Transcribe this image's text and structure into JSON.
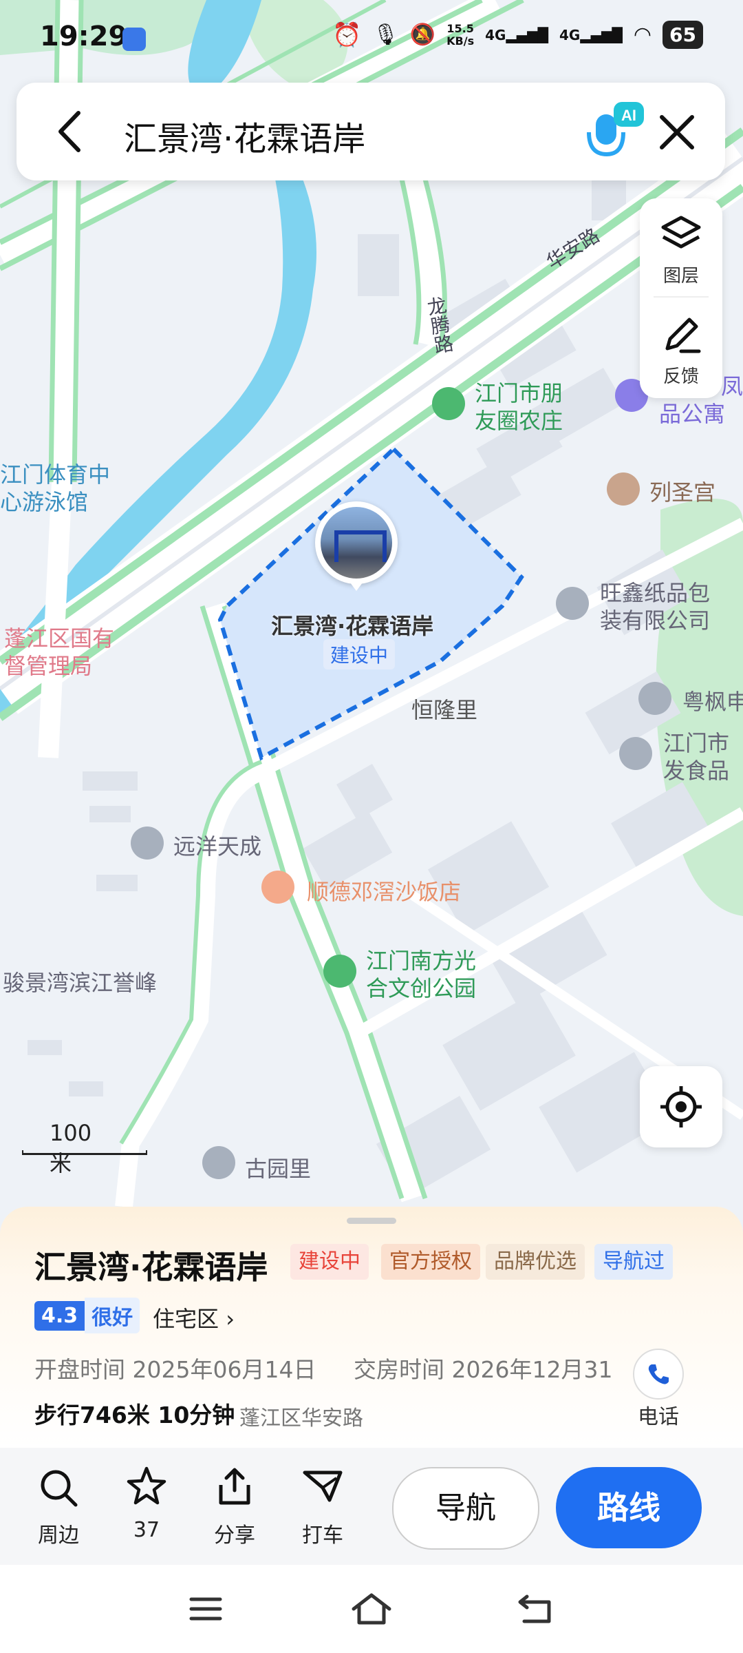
{
  "status_bar": {
    "time": "19:29",
    "net_speed_value": "15.5",
    "net_speed_unit": "KB/s",
    "net1": "4G",
    "net2": "4G",
    "battery": "65"
  },
  "search": {
    "query": "汇景湾·花霖语岸"
  },
  "side_panel": {
    "layers_label": "图层",
    "feedback_label": "反馈"
  },
  "map": {
    "roads": {
      "huaan": "华安路",
      "longteng": "龙腾路"
    },
    "labels": {
      "pengyou_1": "江门市朋",
      "pengyou_2": "友圈农庄",
      "tiyu_1": "江门体育中",
      "tiyu_2": "心游泳馆",
      "lieshenggong": "列圣宫",
      "wangxin_1": "旺鑫纸品包",
      "wangxin_2": "装有限公司",
      "pengjiang_1": "蓬江区国有",
      "pengjiang_2": "督管理局",
      "henglongli": "恒隆里",
      "yuefeng": "粤枫申",
      "jiangmenshi_1": "江门市",
      "jiangmenshi_2": "发食品",
      "yuanyang": "远洋天成",
      "shunde": "顺德邓滘沙饭店",
      "nanfang_1": "江门南方光",
      "nanfang_2": "合文创公园",
      "junjing": "骏景湾滨江誉峰",
      "guyuanli": "古园里",
      "fengdian_1": "凤",
      "fengdian_2": "品公寓"
    },
    "marker": {
      "name": "汇景湾·花霖语岸",
      "status": "建设中"
    },
    "scale": "100米"
  },
  "place": {
    "title": "汇景湾·花霖语岸",
    "tags": [
      "建设中",
      "官方授权",
      "品牌优选",
      "导航过"
    ],
    "score": "4.3",
    "score_word": "很好",
    "category": "住宅区",
    "open_date_label": "开盘时间 2025年06月14日",
    "delivery_date_label": "交房时间 2026年12月31",
    "walk": "步行746米 10分钟",
    "address": "蓬江区华安路",
    "phone_label": "电话"
  },
  "actions": {
    "nearby": "周边",
    "favorites": "37",
    "share": "分享",
    "taxi": "打车",
    "navigate": "导航",
    "route": "路线"
  },
  "colors": {
    "accent": "#1f6ff2",
    "water": "#7fd3f0",
    "green_road": "#a8e6b8",
    "area_fill": "#d6e6fb",
    "area_border": "#1a6fe0"
  }
}
